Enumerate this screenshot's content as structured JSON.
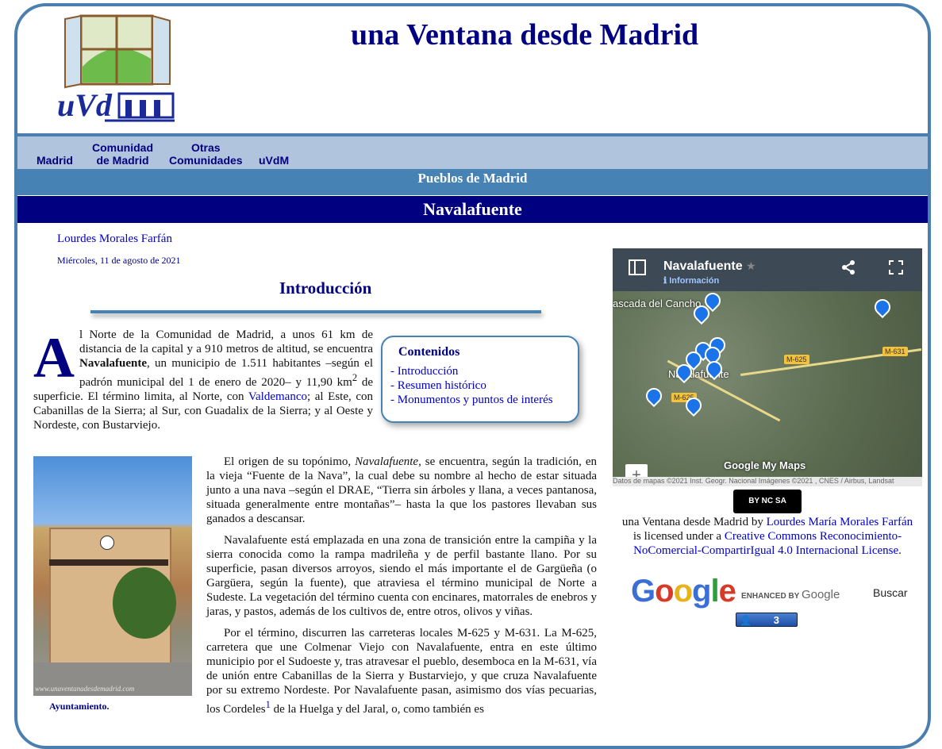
{
  "site": {
    "title": "una Ventana desde Madrid",
    "logo_text": "uVdM"
  },
  "nav": {
    "items": [
      {
        "label": "Madrid"
      },
      {
        "label": "Comunidad de Madrid",
        "line1": "Comunidad",
        "line2": "de Madrid"
      },
      {
        "label": "Otras Comunidades",
        "line1": "Otras",
        "line2": "Comunidades"
      },
      {
        "label": "uVdM"
      }
    ]
  },
  "section": "Pueblos de Madrid",
  "page_title": "Navalafuente",
  "article": {
    "author": "Lourdes Morales Farfán",
    "date": "Miércoles, 11 de agosto de 2021",
    "heading": "Introducción",
    "dropcap": "A",
    "p1_a": "l Norte de la Comunidad de Madrid, a unos 61 km de distancia de la capital y a 910 metros de altitud, se encuentra ",
    "p1_b": "Navalafuente",
    "p1_c": ", un municipio de 1.511 habitantes –según el padrón municipal del 1 de enero de 2020– y 11,90 km",
    "p1_sup": "2",
    "p1_d": " de superficie. El término limita, al Norte, con ",
    "p1_link": "Valdemanco",
    "p1_e": "; al Este, con Cabanillas de la Sierra; al Sur, con Guadalix de la Sierra; y al Oeste y Nordeste, con Bustarviejo.",
    "p2_a": "El origen de su topónimo, ",
    "p2_em": "Navalafuente",
    "p2_b": ", se encuentra, según la tradición, en la vieja “Fuente de la Nava”, la cual debe su nombre al hecho de estar situada junto a una nava –según el DRAE, “Tierra sin árboles y llana, a veces pantanosa, situada generalmente entre montañas”– hasta la que los pastores llevaban sus ganados a descansar.",
    "p3": "Navalafuente está emplazada en una zona de transición entre la campiña y la sierra conocida como la rampa madrileña y de perfil bastante llano. Por su superficie, pasan diversos arroyos, siendo el más importante el de Gargüeña (o Gargüera, según la fuente), que atraviesa el término municipal de Norte a Sudeste. La vegetación del término cuenta con encinares, matorrales de enebros y jaras, y pastos, además de los cultivos de, entre otros, olivos y viñas.",
    "p4_a": "Por el término, discurren las carreteras locales M-625 y M-631. La M-625, carretera que une Colmenar Viejo con Navalafuente, entra en este último municipio por el Sudoeste y, tras atravesar el pueblo, desemboca en la M-631, vía de unión entre Cabanillas de la Sierra y Bustarviejo, y que cruza Navalafuente por su extremo Nordeste. Por Navalafuente pasan, asimismo dos vías pecuarias, los Cordeles",
    "p4_sup": "1",
    "p4_b": " de la Huelga y del Jaral, o, como también es",
    "photo_watermark": "www.unaventanadesdemadrid.com",
    "photo_caption": "Ayuntamiento."
  },
  "toc": {
    "title": "Contenidos",
    "items": [
      "- Introducción",
      "- Resumen histórico",
      "- Monumentos y puntos de interés"
    ]
  },
  "map": {
    "title": "Navalafuente",
    "info": "Información",
    "place_labels": [
      "ascada del Cancho",
      "Navalafuente"
    ],
    "road_labels": [
      "M-625",
      "M-631",
      "M-625"
    ],
    "zoom_in": "+",
    "zoom_out": "−",
    "brand": "Google My Maps",
    "attribution": "Datos de mapas ©2021 Inst. Geogr. Nacional Imágenes ©2021 , CNES / Airbus, Landsat"
  },
  "license": {
    "badge": "BY NC SA",
    "work": "una Ventana desde Madrid",
    "by": " by ",
    "author_link": "Lourdes María Morales Farfán",
    "licensed": " is licensed under a ",
    "license_link": "Creative Commons Reconocimiento-NoComercial-CompartirIgual 4.0 Internacional License",
    "end": "."
  },
  "search": {
    "brand": "Google",
    "enhanced": "ENHANCED BY",
    "enhanced_brand": "Google",
    "button": "Buscar"
  },
  "counter": {
    "value": "3"
  },
  "colors": {
    "frame": "#4a7fb0",
    "nav_bg": "#b0c4de",
    "section_bg": "#4682b4",
    "title_bg": "#000080",
    "link": "#0000cc"
  }
}
